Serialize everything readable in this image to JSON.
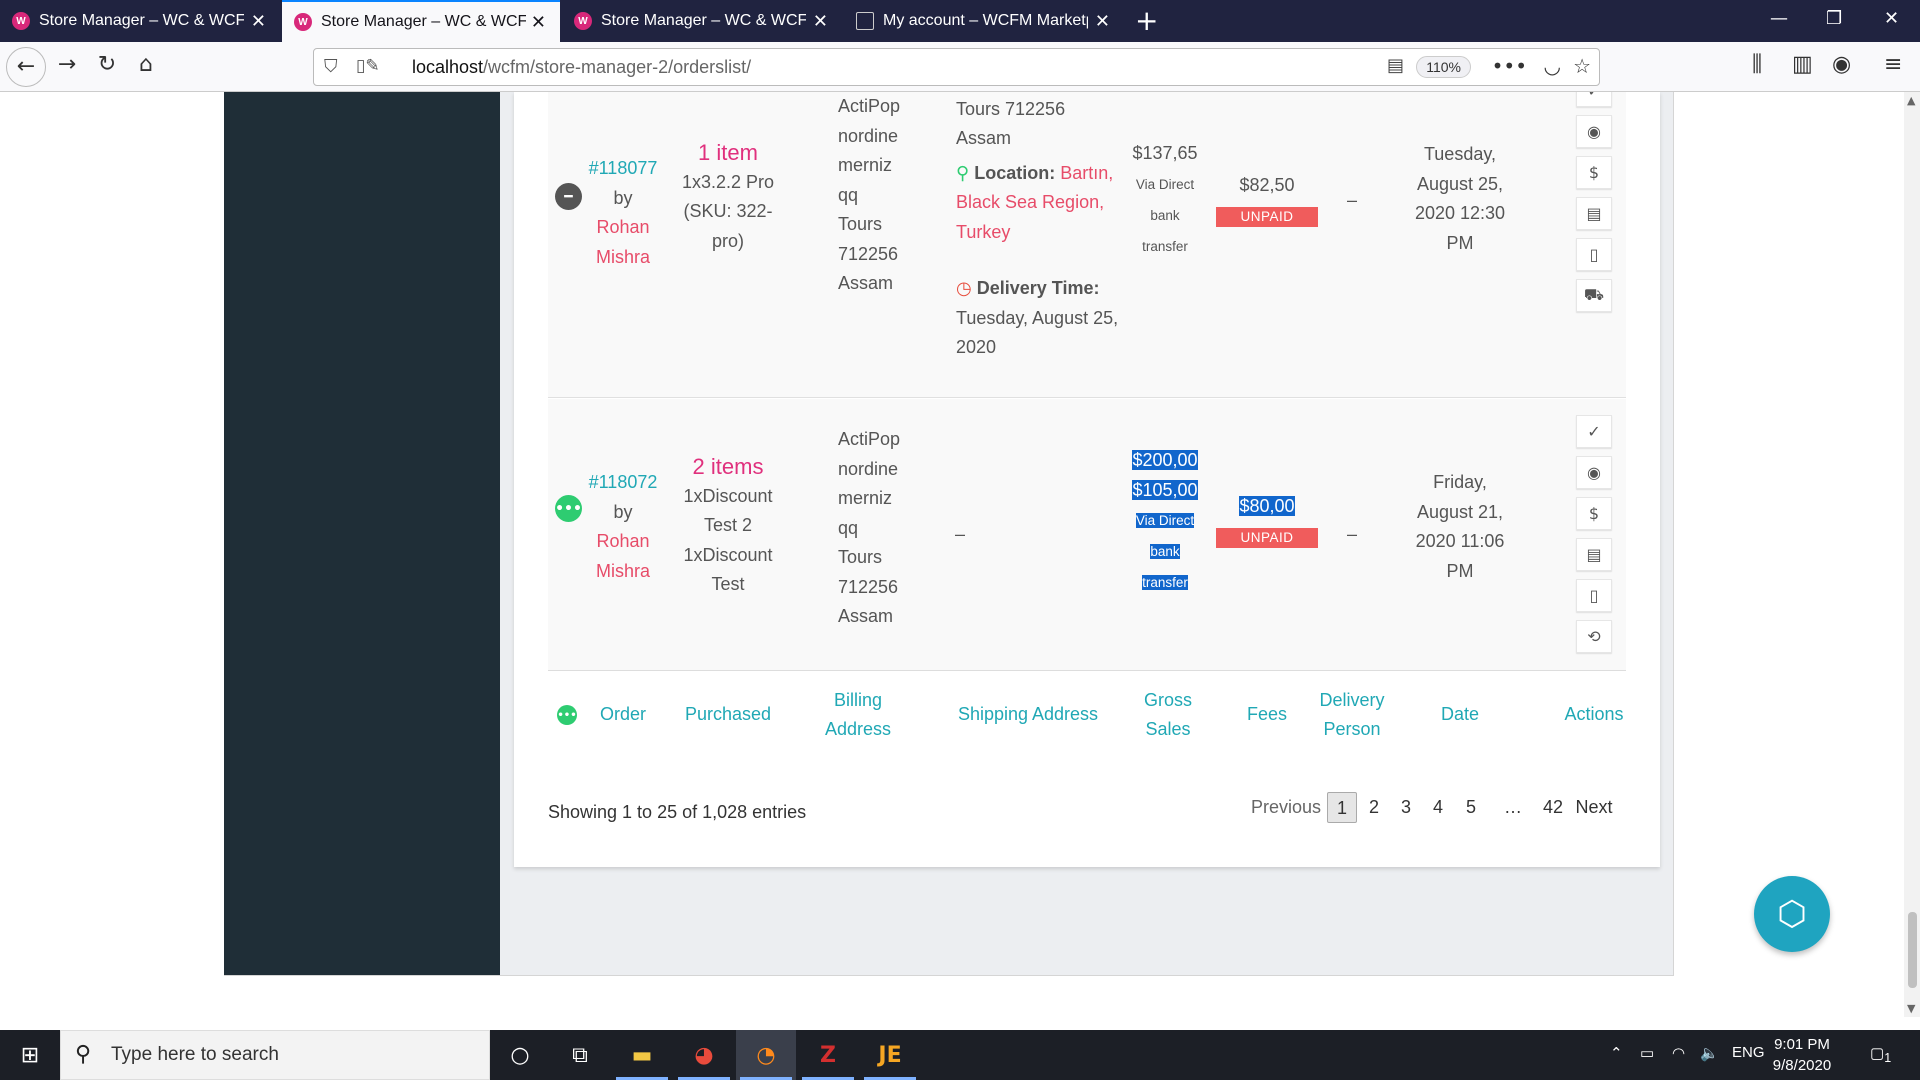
{
  "browser": {
    "tabs": [
      {
        "title": "Store Manager – WC & WCFM",
        "active": false
      },
      {
        "title": "Store Manager – WC & WCFM",
        "active": true
      },
      {
        "title": "Store Manager – WC & WCFM",
        "active": false
      },
      {
        "title": "My account – WCFM Marketpla",
        "active": false
      }
    ],
    "url_host": "localhost",
    "url_path": "/wcfm/store-manager-2/orderslist/",
    "zoom": "110%"
  },
  "orders": [
    {
      "number": "#118077",
      "by_prefix": "by",
      "customer_first": "Rohan",
      "customer_last": "Mishra",
      "items_count": "1 item",
      "item_lines": [
        "1x3.2.2 Pro",
        "(SKU: 322-",
        "pro)"
      ],
      "billing_lines": [
        "ActiPop",
        "nordine",
        "merniz",
        "qq",
        "Tours",
        "712256",
        "Assam"
      ],
      "shipping_top_lines": [
        "qq",
        "Tours 712256",
        "Assam"
      ],
      "location_label": "Location:",
      "location_lines": [
        "Bartın,",
        "Black Sea Region,",
        "Turkey"
      ],
      "delivery_time_label": "Delivery Time:",
      "delivery_time_lines": [
        "Tuesday, August 25,",
        "2020"
      ],
      "gross_amount": "$137,65",
      "gross_method": [
        "Via Direct",
        "bank",
        "transfer"
      ],
      "fees_amount": "$82,50",
      "fees_status": "UNPAID",
      "delivery_person": "–",
      "date_lines": [
        "Tuesday,",
        "August 25,",
        "2020 12:30",
        "PM"
      ],
      "status": "pending"
    },
    {
      "number": "#118072",
      "by_prefix": "by",
      "customer_first": "Rohan",
      "customer_last": "Mishra",
      "items_count": "2 items",
      "item_lines": [
        "1xDiscount",
        "Test 2",
        "1xDiscount",
        "Test"
      ],
      "billing_lines": [
        "ActiPop",
        "nordine",
        "merniz",
        "qq",
        "Tours",
        "712256",
        "Assam"
      ],
      "shipping": "–",
      "gross_amounts": [
        "$200,00",
        "$105,00"
      ],
      "gross_method": [
        "Via Direct",
        "bank",
        "transfer"
      ],
      "fees_amount": "$80,00",
      "fees_status": "UNPAID",
      "delivery_person": "–",
      "date_lines": [
        "Friday,",
        "August 21,",
        "2020 11:06",
        "PM"
      ],
      "status": "processing"
    }
  ],
  "table_headers": {
    "order": "Order",
    "purchased": "Purchased",
    "billing": [
      "Billing",
      "Address"
    ],
    "shipping": "Shipping Address",
    "gross": [
      "Gross",
      "Sales"
    ],
    "fees": "Fees",
    "delivery": [
      "Delivery",
      "Person"
    ],
    "date": "Date",
    "actions": "Actions"
  },
  "footer": {
    "showing": "Showing 1 to 25 of 1,028 entries",
    "previous": "Previous",
    "pages": [
      "1",
      "2",
      "3",
      "4",
      "5"
    ],
    "ellipsis": "…",
    "last_page": "42",
    "next": "Next",
    "current_page": "1"
  },
  "taskbar": {
    "search_placeholder": "Type here to search",
    "language": "ENG",
    "time": "9:01 PM",
    "date": "9/8/2020",
    "notifications": "1"
  },
  "colors": {
    "sidebar": "#1f2e37",
    "teal_link": "#20a8b5",
    "customer_link": "#e74c69",
    "items_link": "#e0307d",
    "unpaid_badge": "#f05c5c",
    "fab": "#1fa4c0"
  }
}
